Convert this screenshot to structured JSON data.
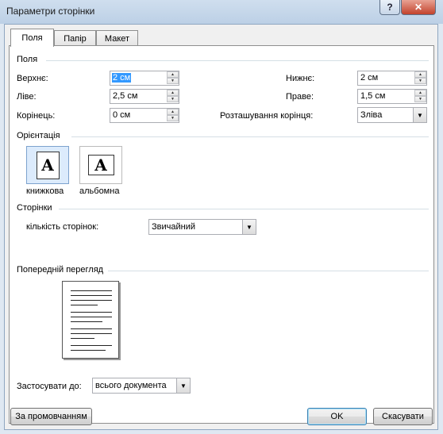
{
  "window": {
    "title": "Параметри сторінки"
  },
  "tabs": [
    {
      "label": "Поля",
      "active": true
    },
    {
      "label": "Папір",
      "active": false
    },
    {
      "label": "Макет",
      "active": false
    }
  ],
  "margins": {
    "section_label": "Поля",
    "top_label": "Верхнє:",
    "top_value": "2 см",
    "bottom_label": "Нижнє:",
    "bottom_value": "2 см",
    "left_label": "Ліве:",
    "left_value": "2,5 см",
    "right_label": "Праве:",
    "right_value": "1,5 см",
    "gutter_label": "Корінець:",
    "gutter_value": "0 см",
    "gutter_pos_label": "Розташування корінця:",
    "gutter_pos_value": "Зліва"
  },
  "orientation": {
    "section_label": "Орієнтація",
    "portrait_label": "книжкова",
    "landscape_label": "альбомна",
    "glyph": "A",
    "selected": "portrait"
  },
  "pages": {
    "section_label": "Сторінки",
    "multiple_label": "кількість сторінок:",
    "multiple_value": "Звичайний"
  },
  "preview": {
    "section_label": "Попередній перегляд"
  },
  "apply": {
    "label": "Застосувати до:",
    "value": "всього документа"
  },
  "buttons": {
    "default_label": "За промовчанням",
    "ok_label": "OK",
    "cancel_label": "Скасувати"
  },
  "icons": {
    "help": "help-icon",
    "close": "close-icon",
    "dropdown": "chevron-down-icon",
    "spin_up": "spin-up-icon",
    "spin_down": "spin-down-icon"
  },
  "colors": {
    "selection": "#3399ff",
    "titlebar": "#c4d6ea",
    "close_button": "#c7432d"
  }
}
